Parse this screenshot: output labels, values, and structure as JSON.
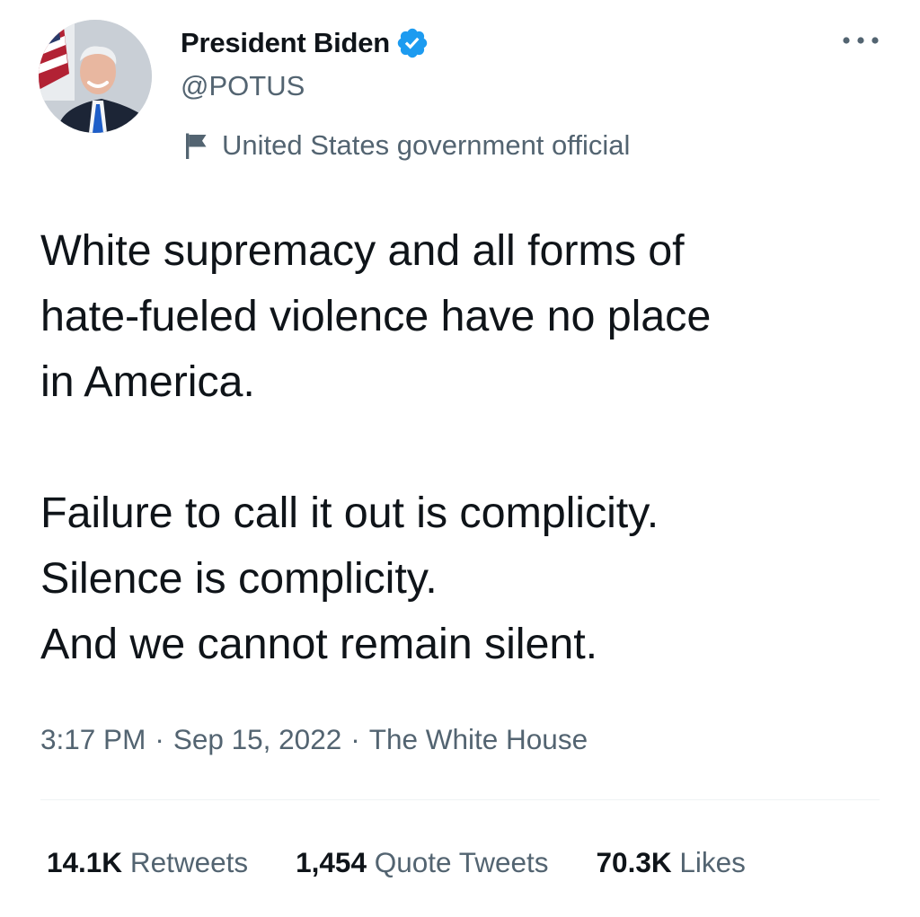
{
  "author": {
    "name": "President Biden",
    "handle": "@POTUS",
    "verified": true,
    "avatar_icon": "profile-photo-man-in-suit",
    "label": "United States government official",
    "label_icon": "flag-icon"
  },
  "tweet": {
    "text": "White supremacy and all forms of\nhate-fueled violence have no place\nin America.\n\nFailure to call it out is complicity.\nSilence is complicity.\nAnd we cannot remain silent."
  },
  "meta": {
    "time": "3:17 PM",
    "date": "Sep 15, 2022",
    "source": "The White House",
    "separator": "·"
  },
  "stats": {
    "retweets": {
      "count": "14.1K",
      "label": "Retweets"
    },
    "quotes": {
      "count": "1,454",
      "label": "Quote Tweets"
    },
    "likes": {
      "count": "70.3K",
      "label": "Likes"
    }
  },
  "colors": {
    "text": "#0f1419",
    "secondary": "#536471",
    "verified_blue": "#1d9bf0",
    "divider": "#eff3f4"
  }
}
